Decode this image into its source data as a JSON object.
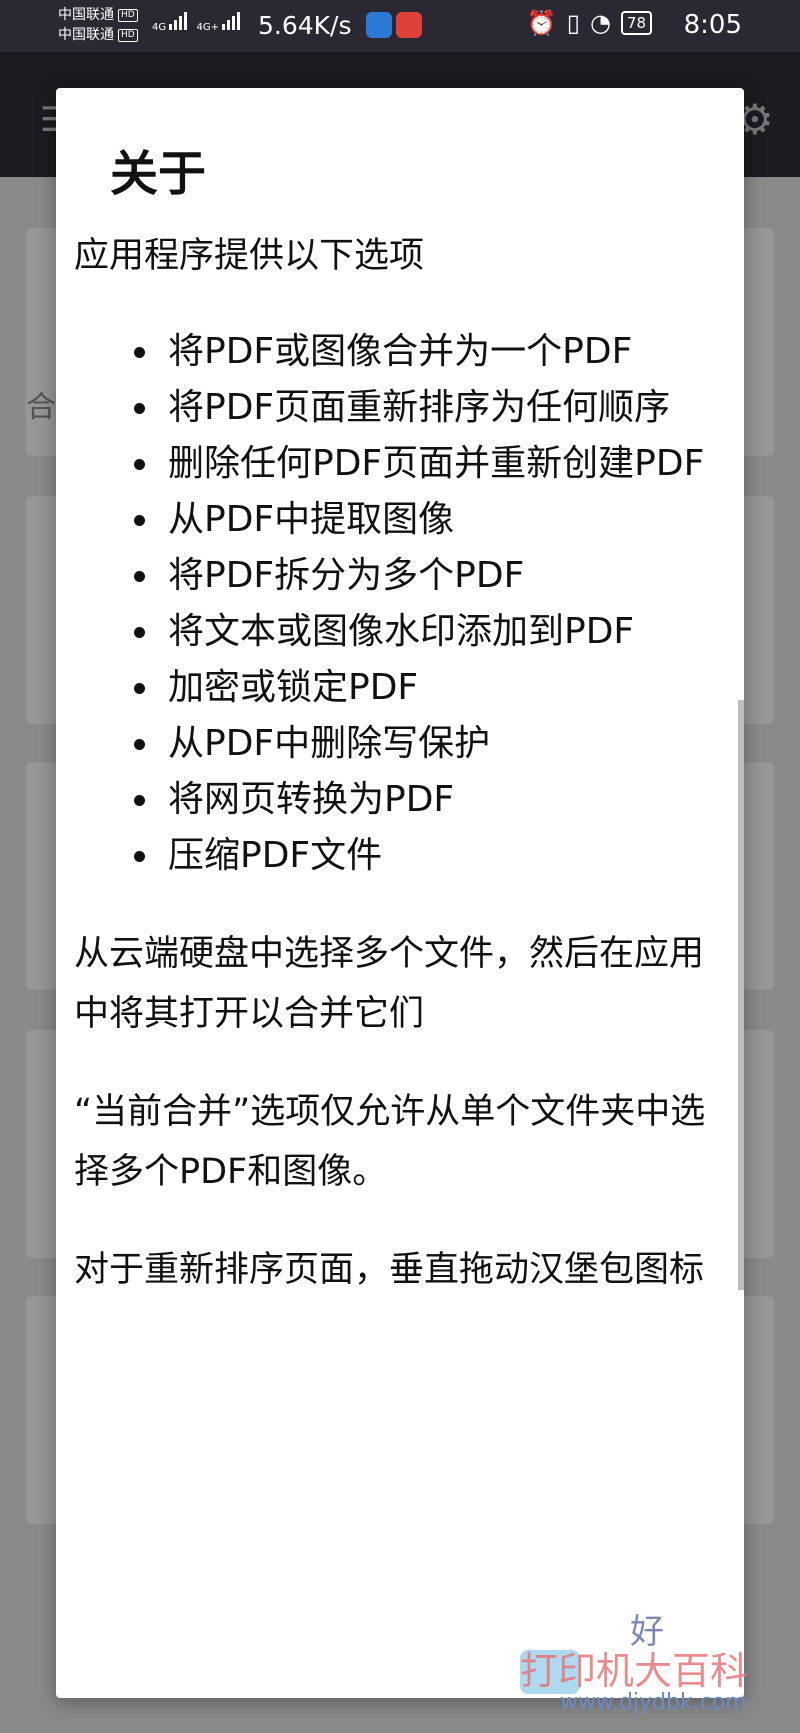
{
  "status_bar": {
    "carrier_1": "中国联通",
    "carrier_2": "中国联通",
    "hd_badge": "HD",
    "network_1": "4G",
    "network_2": "4G+",
    "speed": "5.64K/s",
    "battery": "78",
    "time": "8:05"
  },
  "background": {
    "card_fragment": "合"
  },
  "dialog": {
    "title": "关于",
    "intro": "应用程序提供以下选项",
    "features": [
      "将PDF或图像合并为一个PDF",
      "将PDF页面重新排序为任何顺序",
      "删除任何PDF页面并重新创建PDF",
      "从PDF中提取图像",
      "将PDF拆分为多个PDF",
      "将文本或图像水印添加到PDF",
      "加密或锁定PDF",
      "从PDF中删除写保护",
      "将网页转换为PDF",
      "压缩PDF文件"
    ],
    "paragraphs": [
      "从云端硬盘中选择多个文件，然后在应用中将其打开以合并它们",
      "“当前合并”选项仅允许从单个文件夹中选择多个PDF和图像。",
      "对于重新排序页面，垂直拖动汉堡包图标"
    ],
    "ok_label": "好"
  },
  "watermark": {
    "text": "打印机大百科",
    "url": "www.djydbk.com"
  },
  "icons": {
    "menu": "hamburger-menu-icon",
    "settings": "gear-icon"
  },
  "colors": {
    "accent": "#7e8ab3",
    "status_bar": "#2a2833"
  }
}
